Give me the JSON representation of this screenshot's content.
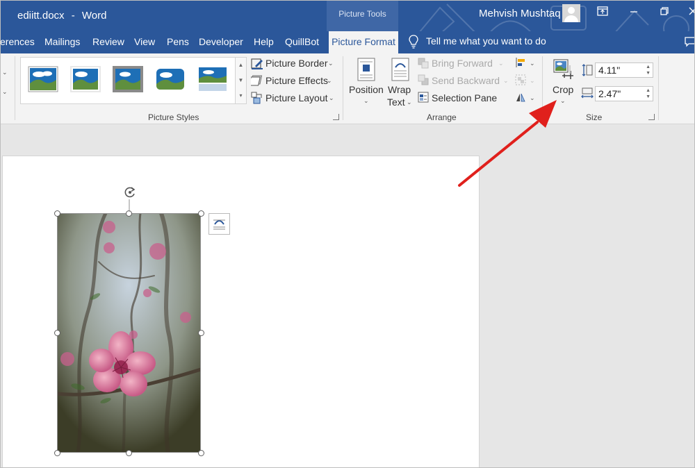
{
  "window": {
    "document_name": "ediitt.docx",
    "separator": "-",
    "app_name": "Word",
    "contextual_header": "Picture Tools",
    "user_name": "Mehvish Mushtaq"
  },
  "tabs": {
    "references": "erences",
    "mailings": "Mailings",
    "review": "Review",
    "view": "View",
    "pens": "Pens",
    "developer": "Developer",
    "help": "Help",
    "quillbot": "QuillBot",
    "picture_format": "Picture Format",
    "tell_me": "Tell me what you want to do"
  },
  "ribbon": {
    "picture_styles": {
      "label": "Picture Styles",
      "picture_border": "Picture Border",
      "picture_effects": "Picture Effects",
      "picture_layout": "Picture Layout"
    },
    "arrange": {
      "label": "Arrange",
      "position": "Position",
      "wrap_line1": "Wrap",
      "wrap_line2": "Text",
      "bring_forward": "Bring Forward",
      "send_backward": "Send Backward",
      "selection_pane": "Selection Pane"
    },
    "size": {
      "label": "Size",
      "crop": "Crop",
      "height": "4.11\"",
      "width": "2.47\""
    }
  },
  "colors": {
    "accent": "#2b579a",
    "annotation_arrow": "#e0201c"
  }
}
